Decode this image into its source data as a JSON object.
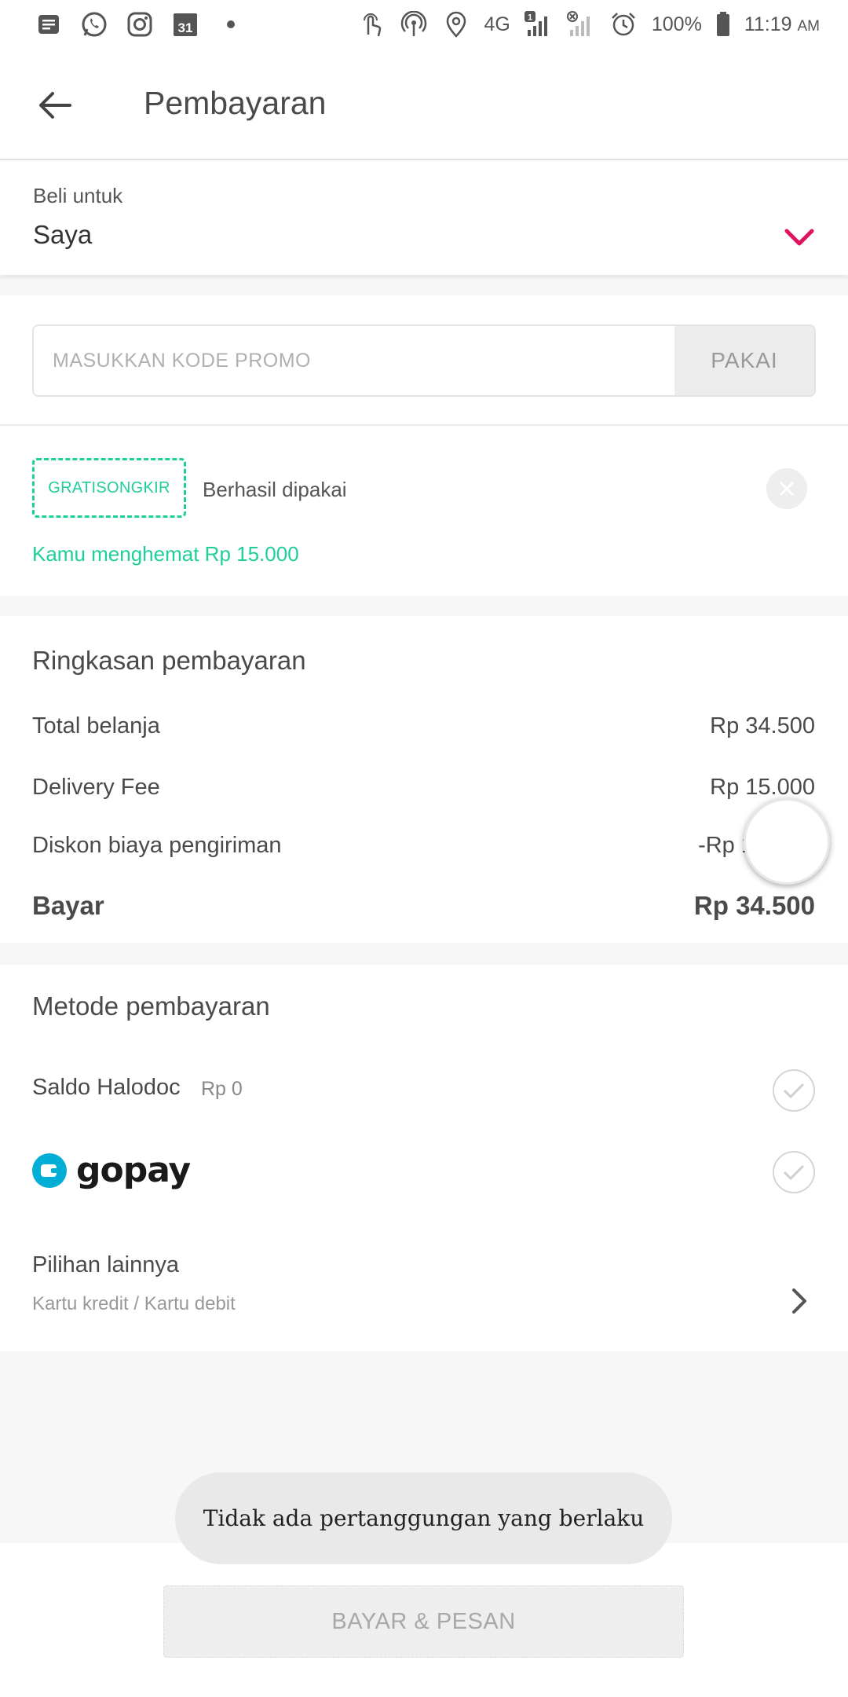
{
  "status_bar": {
    "battery": "100%",
    "time": "11:19",
    "ampm": "AM",
    "network": "4G",
    "calendar_day": "31",
    "sim_badge": "1",
    "icons": [
      "message-icon",
      "whatsapp-icon",
      "instagram-icon",
      "calendar-icon",
      "dot-icon",
      "touch-icon",
      "hotspot-icon",
      "location-icon",
      "signal-icon",
      "no-signal-icon",
      "alarm-icon",
      "battery-icon"
    ]
  },
  "header": {
    "title": "Pembayaran"
  },
  "buy_for": {
    "label": "Beli untuk",
    "value": "Saya"
  },
  "promo": {
    "placeholder": "MASUKKAN KODE PROMO",
    "apply_label": "PAKAI"
  },
  "applied_promo": {
    "code": "GRATISONGKIR",
    "status": "Berhasil dipakai",
    "saving_text": "Kamu menghemat Rp 15.000"
  },
  "summary": {
    "title": "Ringkasan pembayaran",
    "rows": [
      {
        "label": "Total belanja",
        "value": "Rp 34.500"
      },
      {
        "label": "Delivery Fee",
        "value": "Rp 15.000"
      },
      {
        "label": "Diskon biaya pengiriman",
        "value": "-Rp 1"
      }
    ],
    "total_label": "Bayar",
    "total_value": "Rp 34.500"
  },
  "payment_methods": {
    "title": "Metode pembayaran",
    "saldo_label": "Saldo Halodoc",
    "saldo_value": "Rp 0",
    "gopay_label": "gopay",
    "other_label": "Pilihan lainnya",
    "other_sub": "Kartu kredit / Kartu debit"
  },
  "toast": {
    "text": "Tidak ada pertanggungan yang berlaku"
  },
  "footer": {
    "pay_button": "BAYAR & PESAN"
  },
  "colors": {
    "accent_pink": "#e0115f",
    "promo_green": "#1fcf9a",
    "gopay_blue": "#00aed6"
  }
}
